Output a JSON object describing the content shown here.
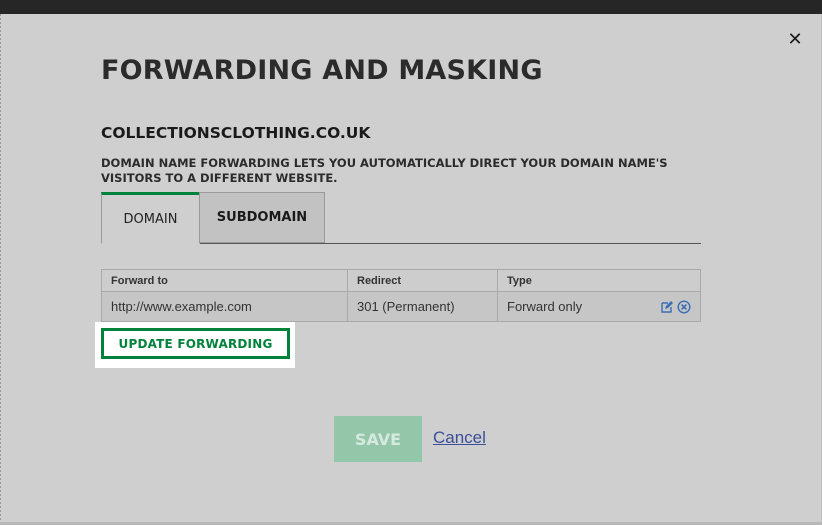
{
  "dialog": {
    "close_symbol": "✕",
    "title": "FORWARDING AND MASKING",
    "domain_name": "COLLECTIONSCLOTHING.CO.UK",
    "description": "DOMAIN NAME FORWARDING LETS YOU AUTOMATICALLY DIRECT YOUR DOMAIN NAME'S VISITORS TO A DIFFERENT WEBSITE."
  },
  "tabs": [
    {
      "label": "DOMAIN",
      "active": true
    },
    {
      "label": "SUBDOMAIN",
      "active": false
    }
  ],
  "table": {
    "headers": [
      "Forward to",
      "Redirect",
      "Type"
    ],
    "rows": [
      {
        "forward_to": "http://www.example.com",
        "redirect": "301 (Permanent)",
        "type": "Forward only",
        "icons": [
          "edit-icon",
          "remove-icon"
        ]
      }
    ]
  },
  "buttons": {
    "update_forwarding": "UPDATE FORWARDING",
    "save": "SAVE",
    "cancel": "Cancel"
  },
  "colors": {
    "accent_green": "#00823b",
    "save_disabled": "#94c7aa",
    "link_blue": "#3a4f98",
    "icon_blue": "#3b6fb6"
  }
}
